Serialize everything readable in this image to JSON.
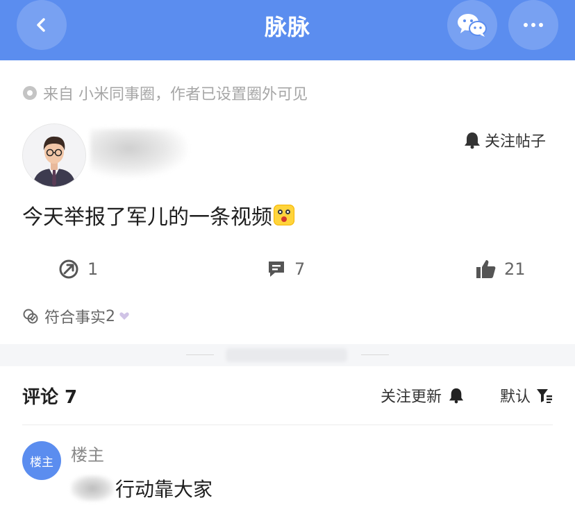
{
  "header": {
    "title": "脉脉",
    "back_icon": "chevron-left-icon",
    "share_icon": "wechat-icon",
    "more_icon": "more-dots-icon",
    "color": "#5b8def"
  },
  "source": {
    "text": "来自 小米同事圈，作者已设置圈外可见"
  },
  "post": {
    "follow_label": "关注帖子",
    "content": "今天举报了军儿的一条视频",
    "forward_count": "1",
    "comment_count": "7",
    "like_count": "21",
    "fact_label": "符合事实",
    "fact_count": "2"
  },
  "comments": {
    "title": "评论 7",
    "follow_updates_label": "关注更新",
    "sort_label": "默认",
    "items": [
      {
        "badge": "楼主",
        "author": "楼主",
        "text": "行动靠大家"
      }
    ]
  }
}
